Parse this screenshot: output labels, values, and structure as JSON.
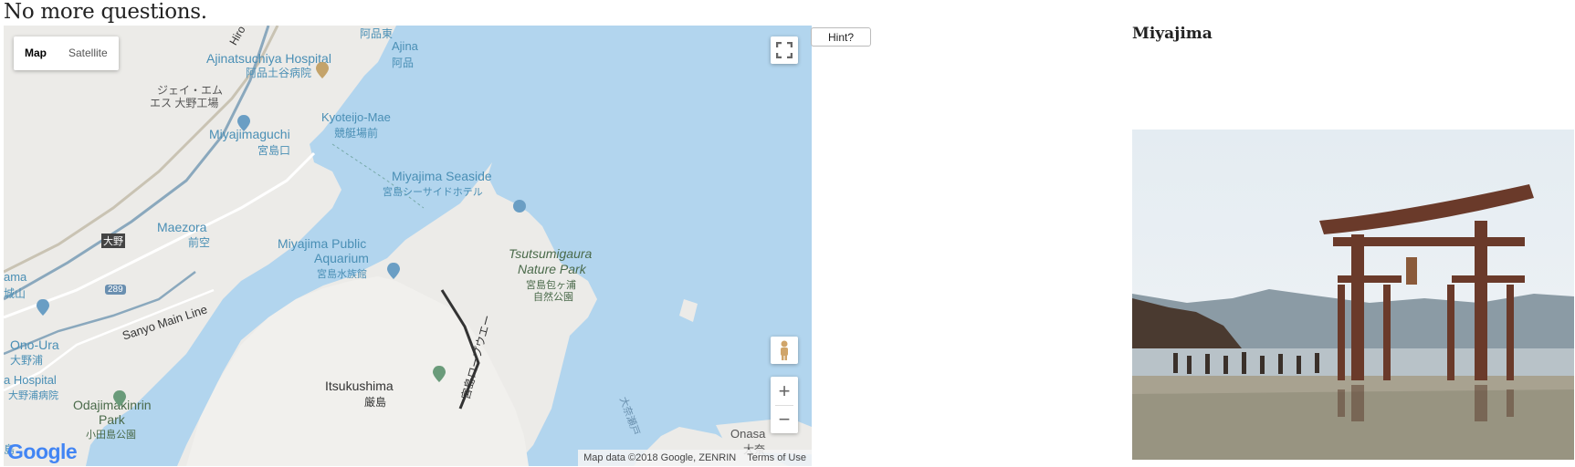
{
  "page": {
    "heading": "No more questions."
  },
  "map": {
    "type_buttons": [
      "Map",
      "Satellite"
    ],
    "selected_type": "Map",
    "labels": {
      "hospital": "Ajinatsuchiya Hospital",
      "hospital_jp": "阿品土谷病院",
      "ajina": "Ajina",
      "ajina_jp": "阿品",
      "ajina_east_jp": "阿品東",
      "jei": "ジェイ・エム",
      "jei2": "エス 大野工場",
      "kyoteijo": "Kyoteijo-Mae",
      "kyoteijo_jp": "競艇場前",
      "miyajimaguchi": "Miyajimaguchi",
      "miyajimaguchi_jp": "宮島口",
      "seaside": "Miyajima Seaside",
      "seaside_jp": "宮島シーサイドホテル",
      "maezora": "Maezora",
      "maezora_jp": "前空",
      "aquarium": "Miyajima Public",
      "aquarium2": "Aquarium",
      "aquarium_jp": "宮島水族館",
      "tsutsumi": "Tsutsumigaura",
      "tsutsumi2": "Nature Park",
      "tsutsumi_jp": "宮島包ヶ浦",
      "tsutsumi_jp2": "自然公園",
      "sanyo": "Sanyo Main Line",
      "onoura": "Ono-Ura",
      "onoura_jp": "大野浦",
      "hospital2": "a Hospital",
      "hospital2_jp": "大野浦病院",
      "odajima": "Odajimakinrin",
      "odajima2": "Park",
      "odajima_jp": "小田島公園",
      "itsukushima": "Itsukushima",
      "itsukushima_jp": "厳島",
      "ropeway": "宮島ロープウエー",
      "channel": "大奈瀬戸",
      "onasa": "Onasa",
      "onasa_jp": "大奈",
      "ama": "ama",
      "shiro": "城山",
      "route": "289",
      "ono_badge": "大野",
      "shima": "島",
      "hiro": "Hiro"
    },
    "google_logo": "Google",
    "attribution": "Map data ©2018 Google, ZENRIN",
    "terms": "Terms of Use",
    "zoom_in": "+",
    "zoom_out": "−"
  },
  "hint_button": "Hint?",
  "answer": {
    "place": "Miyajima"
  }
}
